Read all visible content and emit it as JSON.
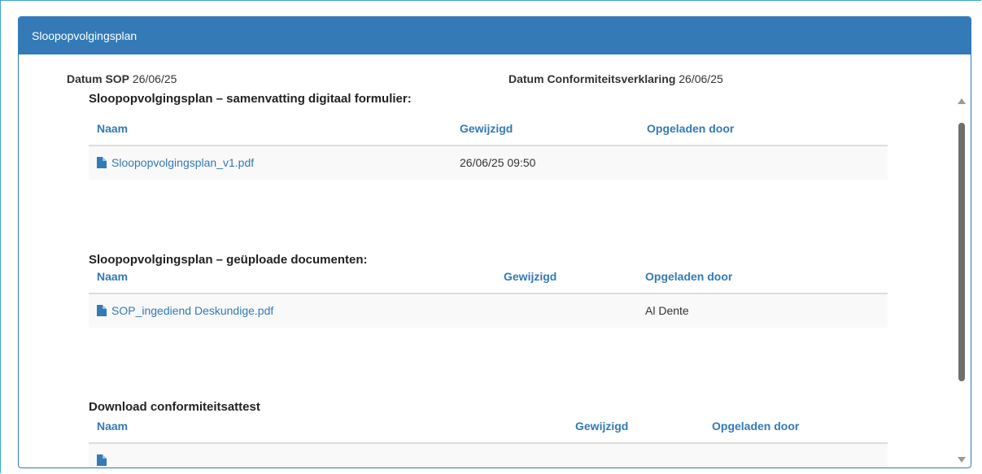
{
  "panel": {
    "title": "Sloopopvolgingsplan"
  },
  "dates": {
    "sop_label": "Datum SOP",
    "sop_value": "26/06/25",
    "conf_label": "Datum Conformiteitsverklaring",
    "conf_value": "26/06/25"
  },
  "sections": [
    {
      "title": "Sloopopvolgingsplan – samenvatting digitaal formulier:",
      "headers": {
        "name": "Naam",
        "modified": "Gewijzigd",
        "uploaded_by": "Opgeladen door"
      },
      "rows": [
        {
          "name": "Sloopopvolgingsplan_v1.pdf",
          "modified": "26/06/25 09:50",
          "uploaded_by": ""
        }
      ]
    },
    {
      "title": "Sloopopvolgingsplan – geüploade documenten:",
      "headers": {
        "name": "Naam",
        "modified": "Gewijzigd",
        "uploaded_by": "Opgeladen door"
      },
      "rows": [
        {
          "name": "SOP_ingediend Deskundige.pdf",
          "modified": "",
          "uploaded_by": "Al Dente"
        }
      ]
    },
    {
      "title": "Download conformiteitsattest",
      "headers": {
        "name": "Naam",
        "modified": "Gewijzigd",
        "uploaded_by": "Opgeladen door"
      },
      "rows": [
        {
          "name": "",
          "modified": "",
          "uploaded_by": ""
        }
      ]
    }
  ],
  "icons": {
    "file": "file-icon"
  },
  "colors": {
    "primary": "#337ab7",
    "frame": "#3aa6d6",
    "row_bg": "#f9f9f9"
  }
}
